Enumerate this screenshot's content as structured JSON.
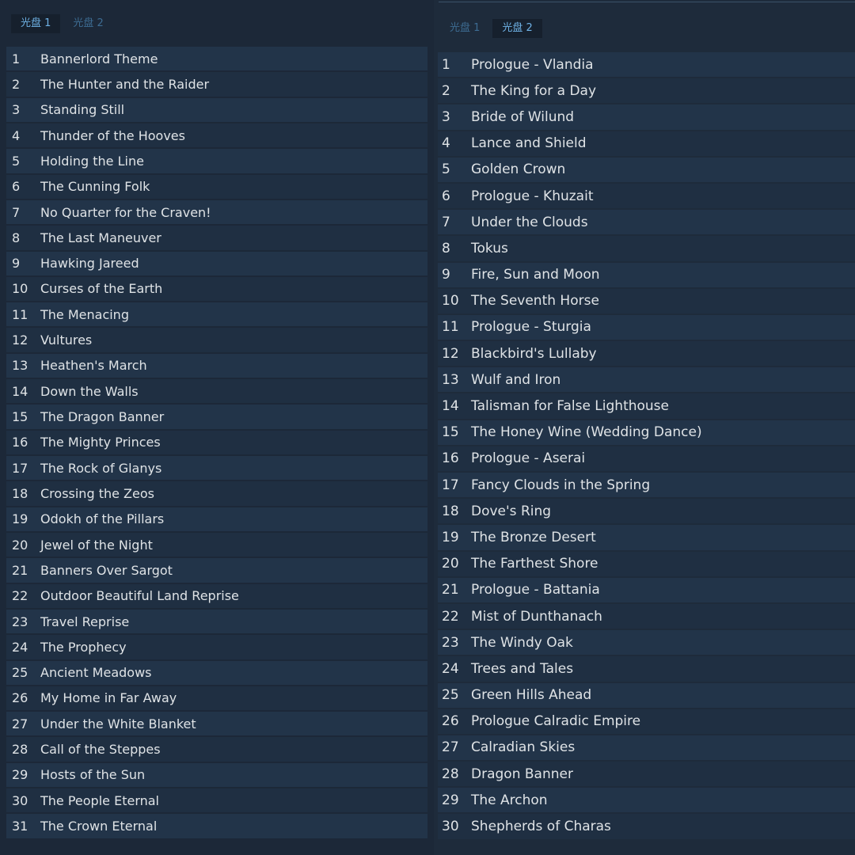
{
  "left_panel": {
    "tabs": [
      {
        "label": "光盘 1",
        "active": true
      },
      {
        "label": "光盘 2",
        "active": false
      }
    ],
    "tracks": [
      {
        "num": "1",
        "title": "Bannerlord Theme"
      },
      {
        "num": "2",
        "title": "The Hunter and the Raider"
      },
      {
        "num": "3",
        "title": "Standing Still"
      },
      {
        "num": "4",
        "title": "Thunder of the Hooves"
      },
      {
        "num": "5",
        "title": "Holding the Line"
      },
      {
        "num": "6",
        "title": "The Cunning Folk"
      },
      {
        "num": "7",
        "title": "No Quarter for the Craven!"
      },
      {
        "num": "8",
        "title": "The Last Maneuver"
      },
      {
        "num": "9",
        "title": "Hawking Jareed"
      },
      {
        "num": "10",
        "title": "Curses of the Earth"
      },
      {
        "num": "11",
        "title": "The Menacing"
      },
      {
        "num": "12",
        "title": "Vultures"
      },
      {
        "num": "13",
        "title": "Heathen's March"
      },
      {
        "num": "14",
        "title": "Down the Walls"
      },
      {
        "num": "15",
        "title": "The Dragon Banner"
      },
      {
        "num": "16",
        "title": "The Mighty Princes"
      },
      {
        "num": "17",
        "title": "The Rock of Glanys"
      },
      {
        "num": "18",
        "title": "Crossing the Zeos"
      },
      {
        "num": "19",
        "title": "Odokh of the Pillars"
      },
      {
        "num": "20",
        "title": "Jewel of the Night"
      },
      {
        "num": "21",
        "title": "Banners Over Sargot"
      },
      {
        "num": "22",
        "title": "Outdoor Beautiful Land Reprise"
      },
      {
        "num": "23",
        "title": "Travel Reprise"
      },
      {
        "num": "24",
        "title": "The Prophecy"
      },
      {
        "num": "25",
        "title": "Ancient Meadows"
      },
      {
        "num": "26",
        "title": "My Home in Far Away"
      },
      {
        "num": "27",
        "title": "Under the White Blanket"
      },
      {
        "num": "28",
        "title": "Call of the Steppes"
      },
      {
        "num": "29",
        "title": "Hosts of the Sun"
      },
      {
        "num": "30",
        "title": "The People Eternal"
      },
      {
        "num": "31",
        "title": "The Crown Eternal"
      }
    ]
  },
  "right_panel": {
    "tabs": [
      {
        "label": "光盘 1",
        "active": false
      },
      {
        "label": "光盘 2",
        "active": true
      }
    ],
    "tracks": [
      {
        "num": "1",
        "title": "Prologue - Vlandia"
      },
      {
        "num": "2",
        "title": "The King for a Day"
      },
      {
        "num": "3",
        "title": "Bride of Wilund"
      },
      {
        "num": "4",
        "title": "Lance and Shield"
      },
      {
        "num": "5",
        "title": "Golden Crown"
      },
      {
        "num": "6",
        "title": "Prologue - Khuzait"
      },
      {
        "num": "7",
        "title": "Under the Clouds"
      },
      {
        "num": "8",
        "title": "Tokus"
      },
      {
        "num": "9",
        "title": "Fire, Sun and Moon"
      },
      {
        "num": "10",
        "title": "The Seventh Horse"
      },
      {
        "num": "11",
        "title": "Prologue - Sturgia"
      },
      {
        "num": "12",
        "title": "Blackbird's Lullaby"
      },
      {
        "num": "13",
        "title": "Wulf and Iron"
      },
      {
        "num": "14",
        "title": "Talisman for False Lighthouse"
      },
      {
        "num": "15",
        "title": "The Honey Wine (Wedding Dance)"
      },
      {
        "num": "16",
        "title": "Prologue - Aserai"
      },
      {
        "num": "17",
        "title": "Fancy Clouds in the Spring"
      },
      {
        "num": "18",
        "title": "Dove's Ring"
      },
      {
        "num": "19",
        "title": "The Bronze Desert"
      },
      {
        "num": "20",
        "title": "The Farthest Shore"
      },
      {
        "num": "21",
        "title": "Prologue - Battania"
      },
      {
        "num": "22",
        "title": "Mist of Dunthanach"
      },
      {
        "num": "23",
        "title": "The Windy Oak"
      },
      {
        "num": "24",
        "title": "Trees and Tales"
      },
      {
        "num": "25",
        "title": "Green Hills Ahead"
      },
      {
        "num": "26",
        "title": "Prologue Calradic Empire"
      },
      {
        "num": "27",
        "title": "Calradian Skies"
      },
      {
        "num": "28",
        "title": "Dragon Banner"
      },
      {
        "num": "29",
        "title": "The Archon"
      },
      {
        "num": "30",
        "title": "Shepherds of Charas"
      }
    ]
  },
  "colors": {
    "background": "#1b2838",
    "row": "#223449",
    "row_alt": "#1f2f42",
    "active_tab_bg": "#16202d",
    "active_tab_text": "#6fb2e6",
    "inactive_tab_text": "#3d6c93",
    "text": "#dfe3e6"
  }
}
